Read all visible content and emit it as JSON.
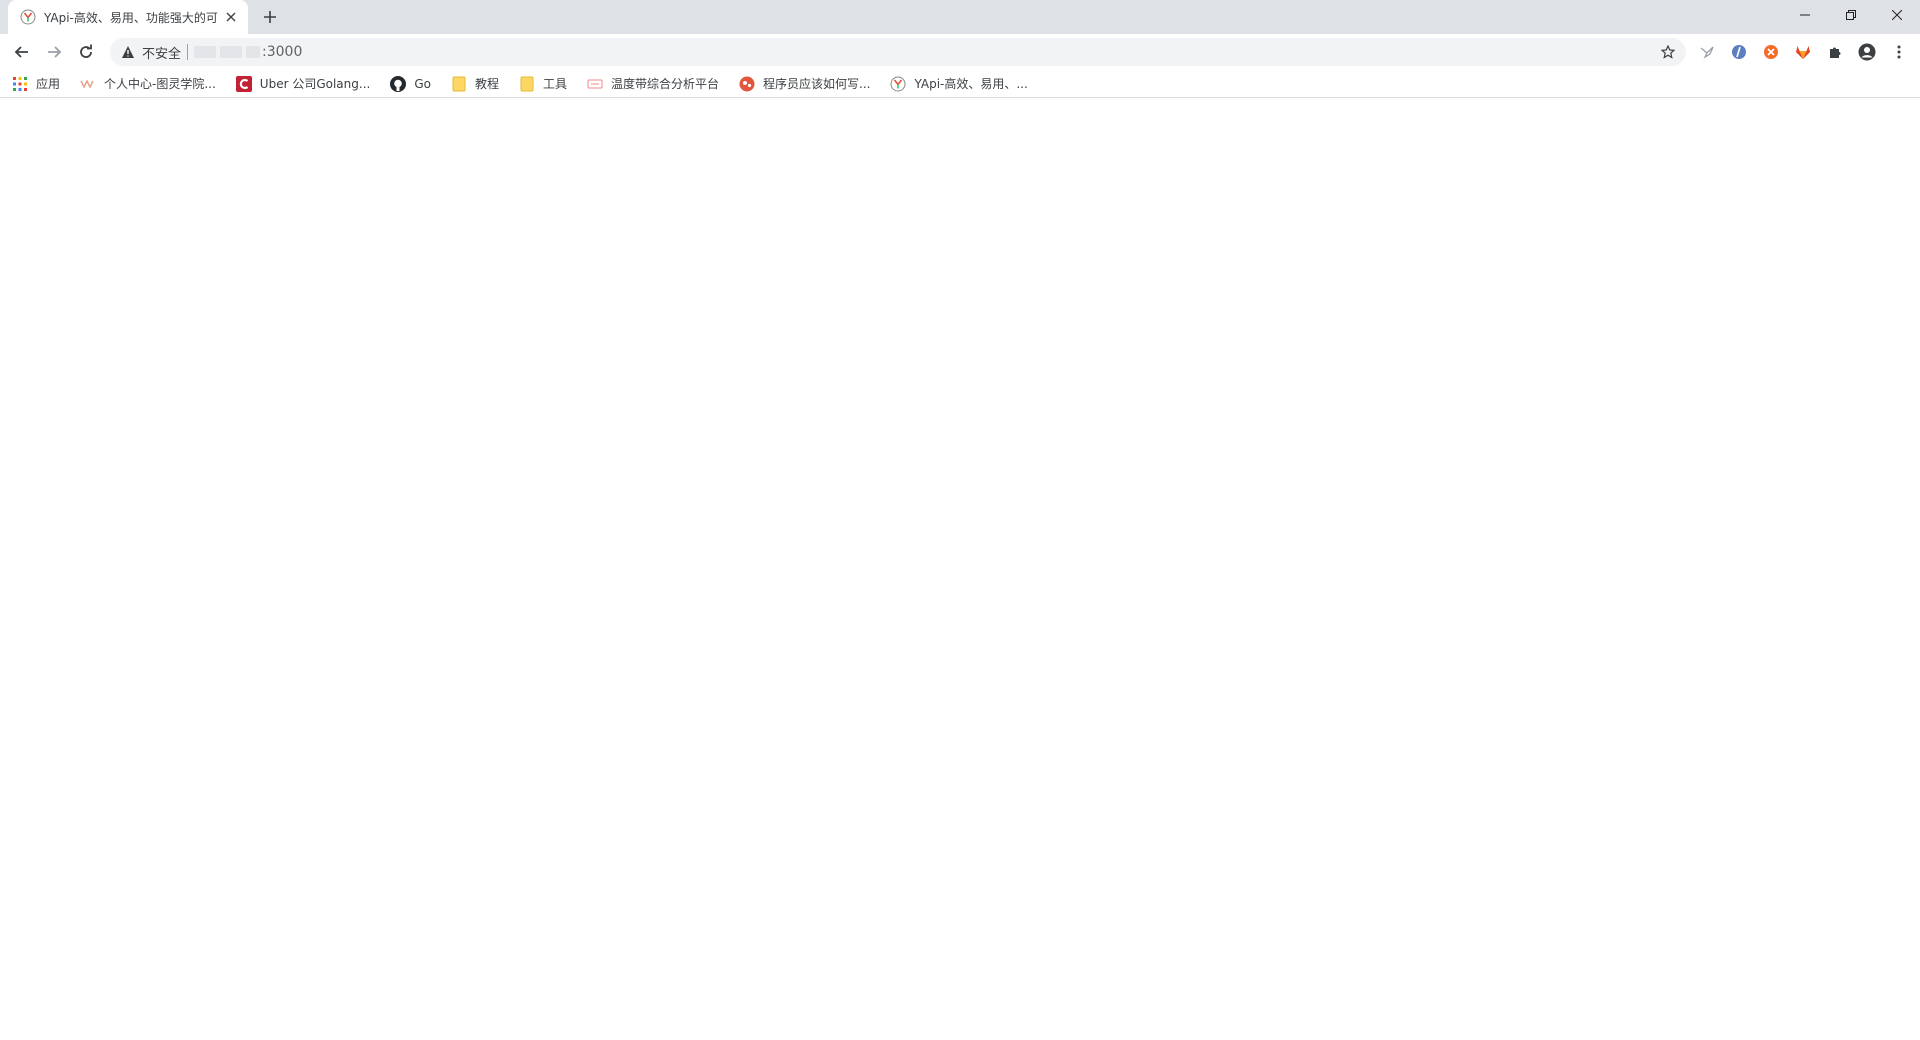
{
  "tab": {
    "title": "YApi-高效、易用、功能强大的可",
    "favicon": "yapi-logo-icon"
  },
  "window_controls": [
    "minimize-icon",
    "restore-icon",
    "close-icon"
  ],
  "omnibox": {
    "security_label": "不安全",
    "url_suffix": ":3000"
  },
  "bookmarks": [
    {
      "label": "应用",
      "icon": "apps-grid-icon"
    },
    {
      "label": "个人中心-图灵学院...",
      "icon": "tuling-icon"
    },
    {
      "label": "Uber 公司Golang...",
      "icon": "csdn-icon"
    },
    {
      "label": "Go",
      "icon": "github-icon"
    },
    {
      "label": "教程",
      "icon": "folder-icon"
    },
    {
      "label": "工具",
      "icon": "folder-icon"
    },
    {
      "label": "温度带综合分析平台",
      "icon": "platform-icon"
    },
    {
      "label": "程序员应该如何写...",
      "icon": "article-icon"
    },
    {
      "label": "YApi-高效、易用、...",
      "icon": "yapi-logo-icon"
    }
  ],
  "colors": {
    "tabstrip_bg": "#dee1e6",
    "omnibox_bg": "#f1f3f4",
    "folder_yellow": "#fdd663",
    "gitlab_orange": "#e24329",
    "csdn_red": "#c32136"
  }
}
